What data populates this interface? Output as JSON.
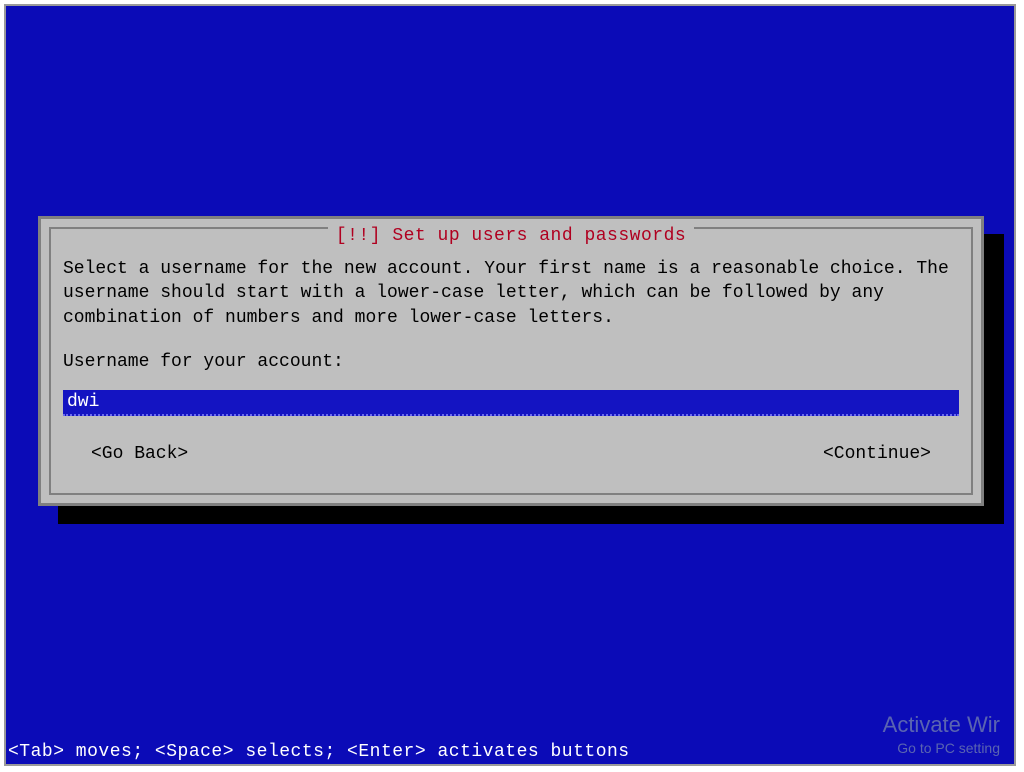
{
  "dialog": {
    "title": "[!!] Set up users and passwords",
    "instruction": "Select a username for the new account. Your first name is a reasonable choice. The username should start with a lower-case letter, which can be followed by any combination of numbers and more lower-case letters.",
    "field_label": "Username for your account:",
    "input_value": "dwi",
    "go_back_label": "<Go Back>",
    "continue_label": "<Continue>"
  },
  "help_bar": "<Tab> moves; <Space> selects; <Enter> activates buttons",
  "watermark": {
    "line1": "Activate Wir",
    "line2": "Go to PC setting"
  }
}
